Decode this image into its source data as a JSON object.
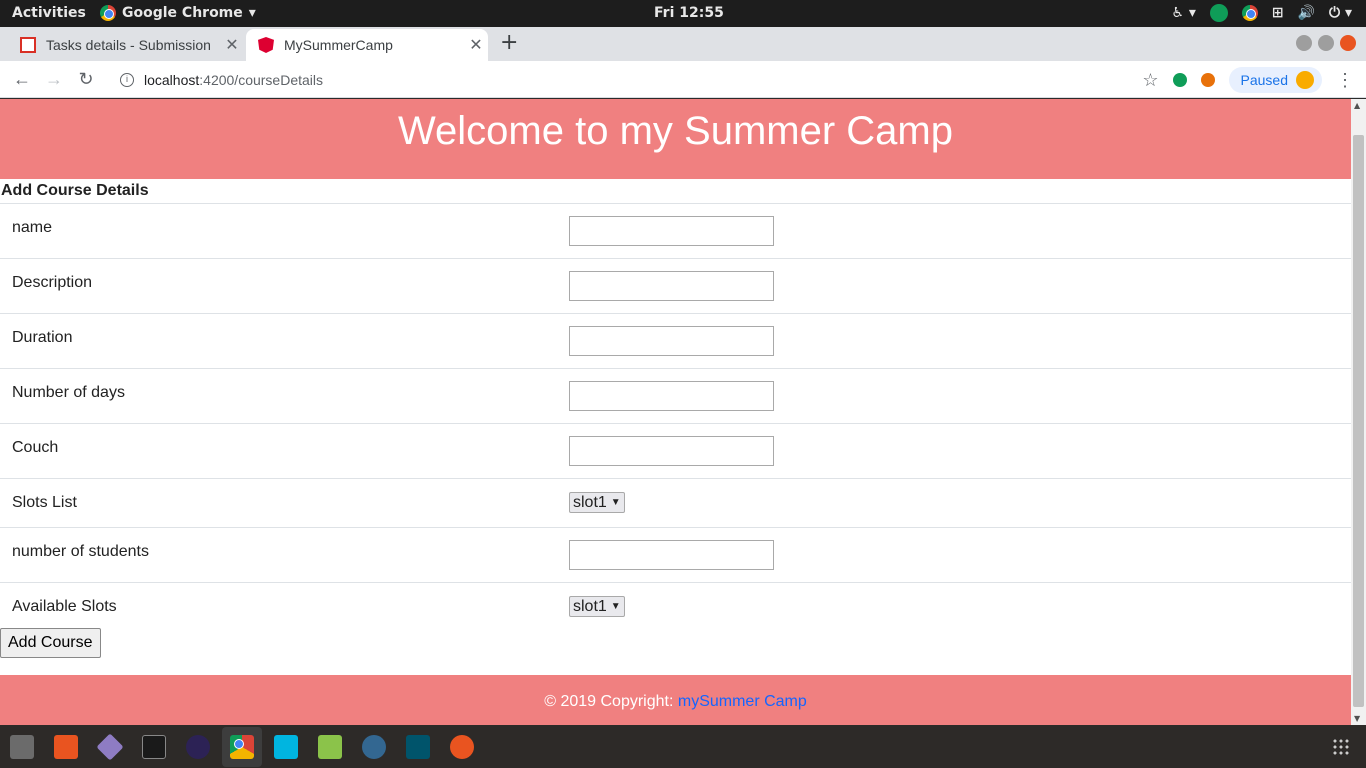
{
  "system": {
    "activities": "Activities",
    "app_name": "Google Chrome",
    "clock": "Fri 12:55"
  },
  "tabs": [
    {
      "title": "Tasks details - Submission",
      "active": false,
      "icon": "gmail-icon"
    },
    {
      "title": "MySummerCamp",
      "active": true,
      "icon": "angular-icon"
    }
  ],
  "address": {
    "host": "localhost",
    "path": ":4200/courseDetails",
    "profile_status": "Paused"
  },
  "page": {
    "hero_title": "Welcome to my Summer Camp",
    "section_title": "Add Course Details",
    "fields": [
      {
        "label": "name",
        "type": "text",
        "value": ""
      },
      {
        "label": "Description",
        "type": "text",
        "value": ""
      },
      {
        "label": "Duration",
        "type": "text",
        "value": ""
      },
      {
        "label": "Number of days",
        "type": "text",
        "value": ""
      },
      {
        "label": "Couch",
        "type": "text",
        "value": ""
      },
      {
        "label": "Slots List",
        "type": "select",
        "value": "slot1"
      },
      {
        "label": "number of students",
        "type": "text",
        "value": ""
      },
      {
        "label": "Available Slots",
        "type": "select",
        "value": "slot1"
      }
    ],
    "submit_label": "Add Course",
    "footer_text": "© 2019 Copyright: ",
    "footer_link": "mySummer Camp"
  },
  "colors": {
    "brand": "#f08080",
    "link": "#1565ff"
  }
}
